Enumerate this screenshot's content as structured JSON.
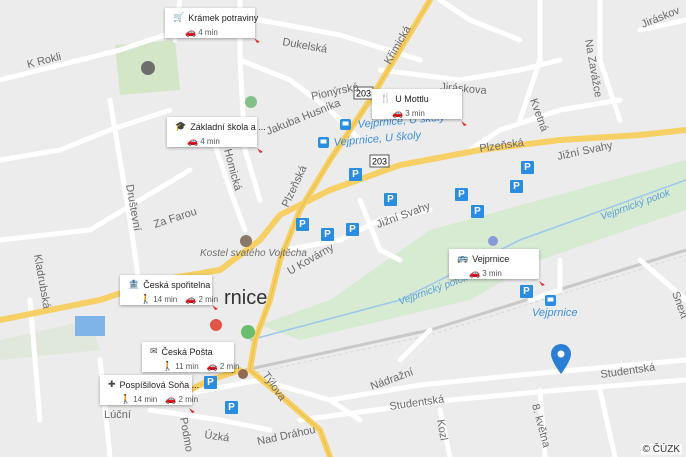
{
  "map": {
    "town": "rnice",
    "streets": [
      "K Rokli",
      "Dukelská",
      "Jiráskov",
      "Jiráskova",
      "Na Zavážce",
      "Pionýrská",
      "Jakuba Husníka",
      "Křimická",
      "Plzeňská",
      "Jižní Svahy",
      "Kvetná",
      "Homická",
      "Društevní",
      "Za Farou",
      "U Kovárny",
      "Kladrubská",
      "Česká",
      "Nádražní",
      "Studentská",
      "Týlova",
      "Lúční",
      "Podmo",
      "Úzká",
      "Nad Dráhou",
      "Kozl",
      "8. května",
      "Snext"
    ],
    "road_shields": [
      "203",
      "203"
    ],
    "stops": [
      "Vejprnice, U školy",
      "Vejprnice, U školy",
      "Vejprnice"
    ],
    "water": [
      "Vejprnický potok",
      "Vejprnický potok"
    ],
    "poi": [
      "Kostel svatého Vojtěcha"
    ]
  },
  "cards": [
    {
      "name": "Krámek potraviny",
      "icon": "cart-icon",
      "lines": [
        {
          "icon": "car-icon",
          "text": "4 min"
        }
      ]
    },
    {
      "name": "Základní škola a ...",
      "icon": "school-icon",
      "lines": [
        {
          "icon": "car-icon",
          "text": "4 min"
        }
      ]
    },
    {
      "name": "U Mottlu",
      "icon": "restaurant-icon",
      "lines": [
        {
          "icon": "car-icon",
          "text": "3 min"
        }
      ]
    },
    {
      "name": "Vejprnice",
      "icon": "bus-icon",
      "lines": [
        {
          "icon": "car-icon",
          "text": "3 min"
        }
      ]
    },
    {
      "name": "Česká spořitelna",
      "icon": "bank-icon",
      "lines": [
        {
          "icon": "walk-icon",
          "text": "14 min"
        },
        {
          "icon": "car-icon",
          "text": "2 min"
        }
      ]
    },
    {
      "name": "Česká Pošta",
      "icon": "post-icon",
      "lines": [
        {
          "icon": "walk-icon",
          "text": "11 min"
        },
        {
          "icon": "car-icon",
          "text": "2 min"
        }
      ]
    },
    {
      "name": "Pospíšilová Soňa ...",
      "icon": "medical-icon",
      "lines": [
        {
          "icon": "walk-icon",
          "text": "14 min"
        },
        {
          "icon": "car-icon",
          "text": "2 min"
        }
      ]
    }
  ],
  "parking_symbol": "P",
  "copyright": "© ČÚZK",
  "colors": {
    "main_road": "#f6cf65",
    "road": "#ffffff",
    "green": "#d7ead2",
    "water": "#7fb4e8",
    "marker": "#2a7fd4"
  }
}
